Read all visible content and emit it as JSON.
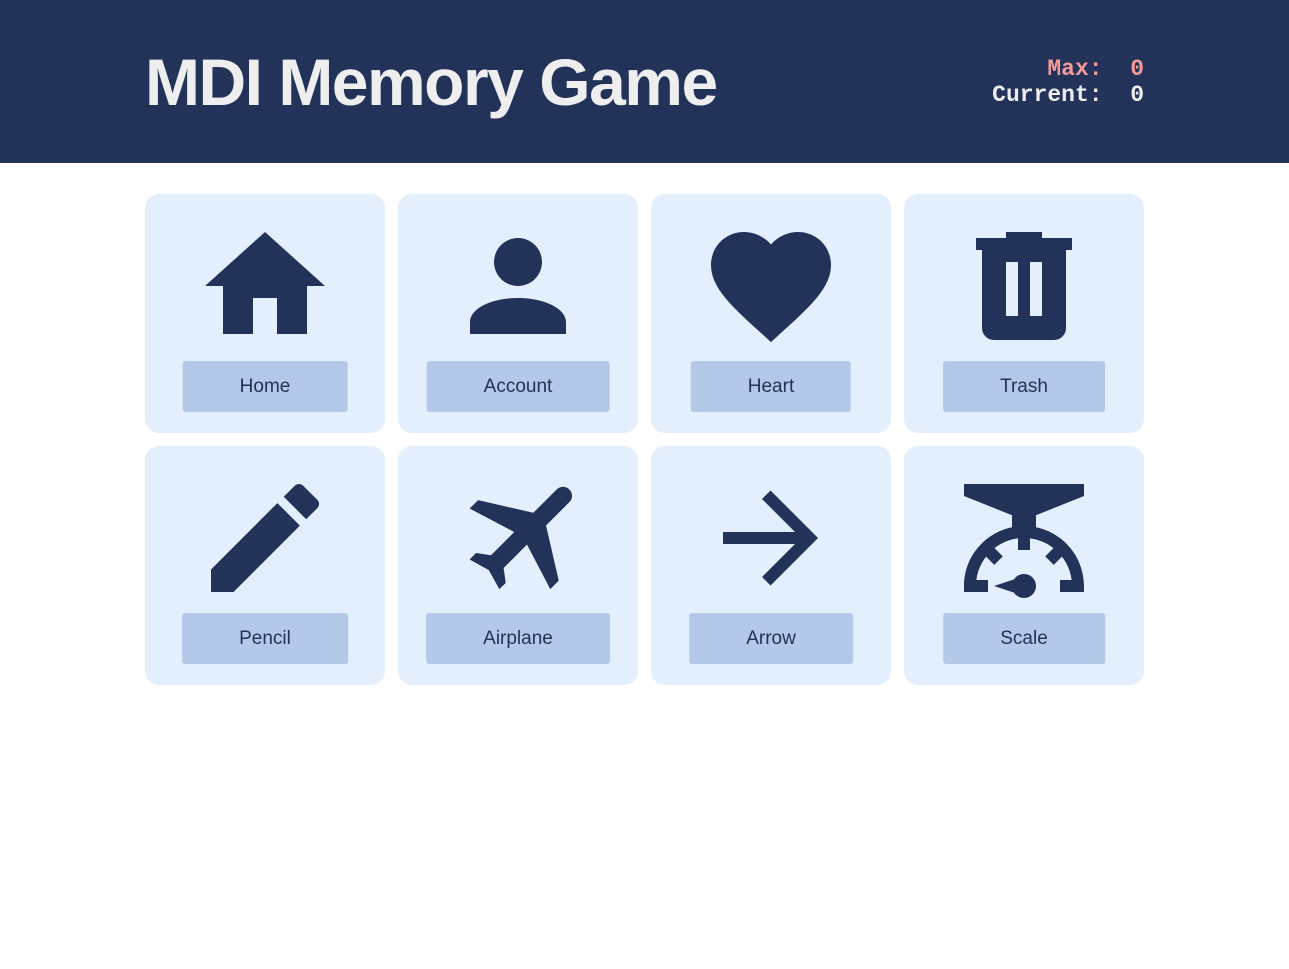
{
  "header": {
    "title": "MDI Memory Game",
    "max_label": "Max:",
    "max_value": "0",
    "current_label": "Current:",
    "current_value": "0"
  },
  "cards": [
    {
      "label": "Home",
      "icon": "home-icon"
    },
    {
      "label": "Account",
      "icon": "account-icon"
    },
    {
      "label": "Heart",
      "icon": "heart-icon"
    },
    {
      "label": "Trash",
      "icon": "trash-icon"
    },
    {
      "label": "Pencil",
      "icon": "pencil-icon"
    },
    {
      "label": "Airplane",
      "icon": "airplane-icon"
    },
    {
      "label": "Arrow",
      "icon": "arrow-right-icon"
    },
    {
      "label": "Scale",
      "icon": "scale-icon"
    }
  ],
  "colors": {
    "primary": "#223259",
    "card": "#e3effd",
    "label_bg": "#b3c9e7",
    "max": "#f49a9a"
  }
}
